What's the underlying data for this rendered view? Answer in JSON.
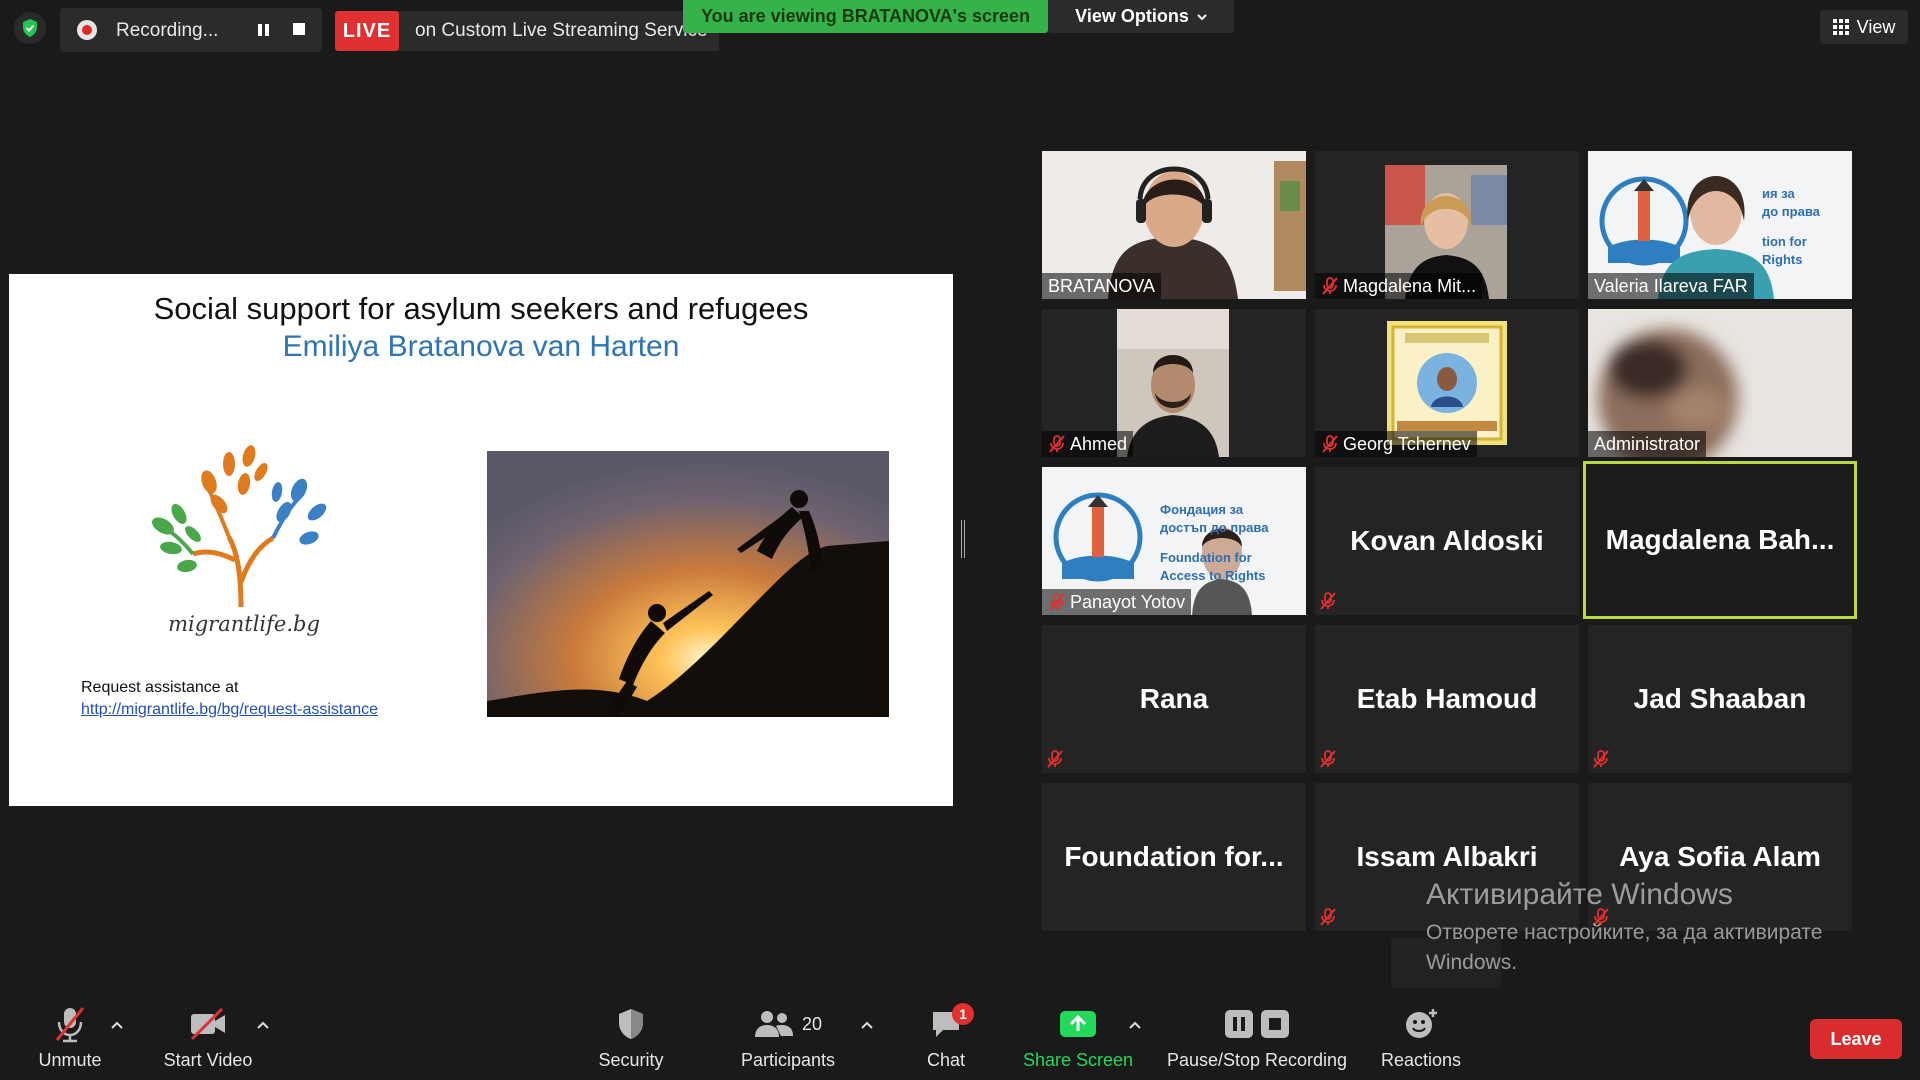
{
  "top_bar": {
    "recording_label": "Recording...",
    "live_badge": "LIVE",
    "live_text": "on Custom Live Streaming Service",
    "viewing_banner": "You are viewing BRATANOVA's screen",
    "view_options": "View Options",
    "view_label": "View"
  },
  "slide": {
    "title": "Social support for asylum seekers and refugees",
    "subtitle": "Emiliya Bratanova van Harten",
    "logo_text": "migrantlife.bg",
    "request_label": "Request assistance at",
    "request_link": "http://migrantlife.bg/bg/request-assistance"
  },
  "gallery": {
    "video_tiles": [
      {
        "name": "BRATANOVA",
        "muted": false
      },
      {
        "name": "Magdalena Mit...",
        "muted": true
      },
      {
        "name": "Valeria Ilareva FAR",
        "muted": false
      },
      {
        "name": "Ahmed",
        "muted": true
      },
      {
        "name": "Georg Tchernev",
        "muted": true
      },
      {
        "name": "Administrator",
        "muted": false
      },
      {
        "name": "Panayot Yotov",
        "muted": true
      }
    ],
    "name_tiles": [
      {
        "name": "Kovan Aldoski",
        "muted": true
      },
      {
        "name": "Magdalena  Bah...",
        "muted": false,
        "active": true
      },
      {
        "name": "Rana",
        "muted": true
      },
      {
        "name": "Etab Hamoud",
        "muted": true
      },
      {
        "name": "Jad Shaaban",
        "muted": true
      },
      {
        "name": "Foundation  for...",
        "muted": false
      },
      {
        "name": "Issam Albakri",
        "muted": true
      },
      {
        "name": "Aya Sofia Alam",
        "muted": true
      }
    ],
    "logo_overlay_lines": [
      "Фондация за",
      "достъп до права",
      "Foundation for",
      "Access to Rights"
    ],
    "logo_overlay_visible": [
      "ия за",
      "до права",
      "tion for",
      "Rights"
    ]
  },
  "watermark": {
    "line1": "Активирайте Windows",
    "line2": "Отворете настройките, за да активирате",
    "line3": "Windows."
  },
  "toolbar": {
    "unmute": "Unmute",
    "start_video": "Start Video",
    "security": "Security",
    "participants": "Participants",
    "participants_count": "20",
    "chat": "Chat",
    "chat_badge": "1",
    "share_screen": "Share Screen",
    "pause_stop": "Pause/Stop Recording",
    "reactions": "Reactions",
    "leave": "Leave"
  },
  "colors": {
    "banner_green": "#35b34a",
    "live_red": "#e0302f",
    "share_green": "#23d959",
    "active_speaker": "#b8d943",
    "link_blue": "#1f4fb5",
    "subtitle_blue": "#2e74b5"
  }
}
